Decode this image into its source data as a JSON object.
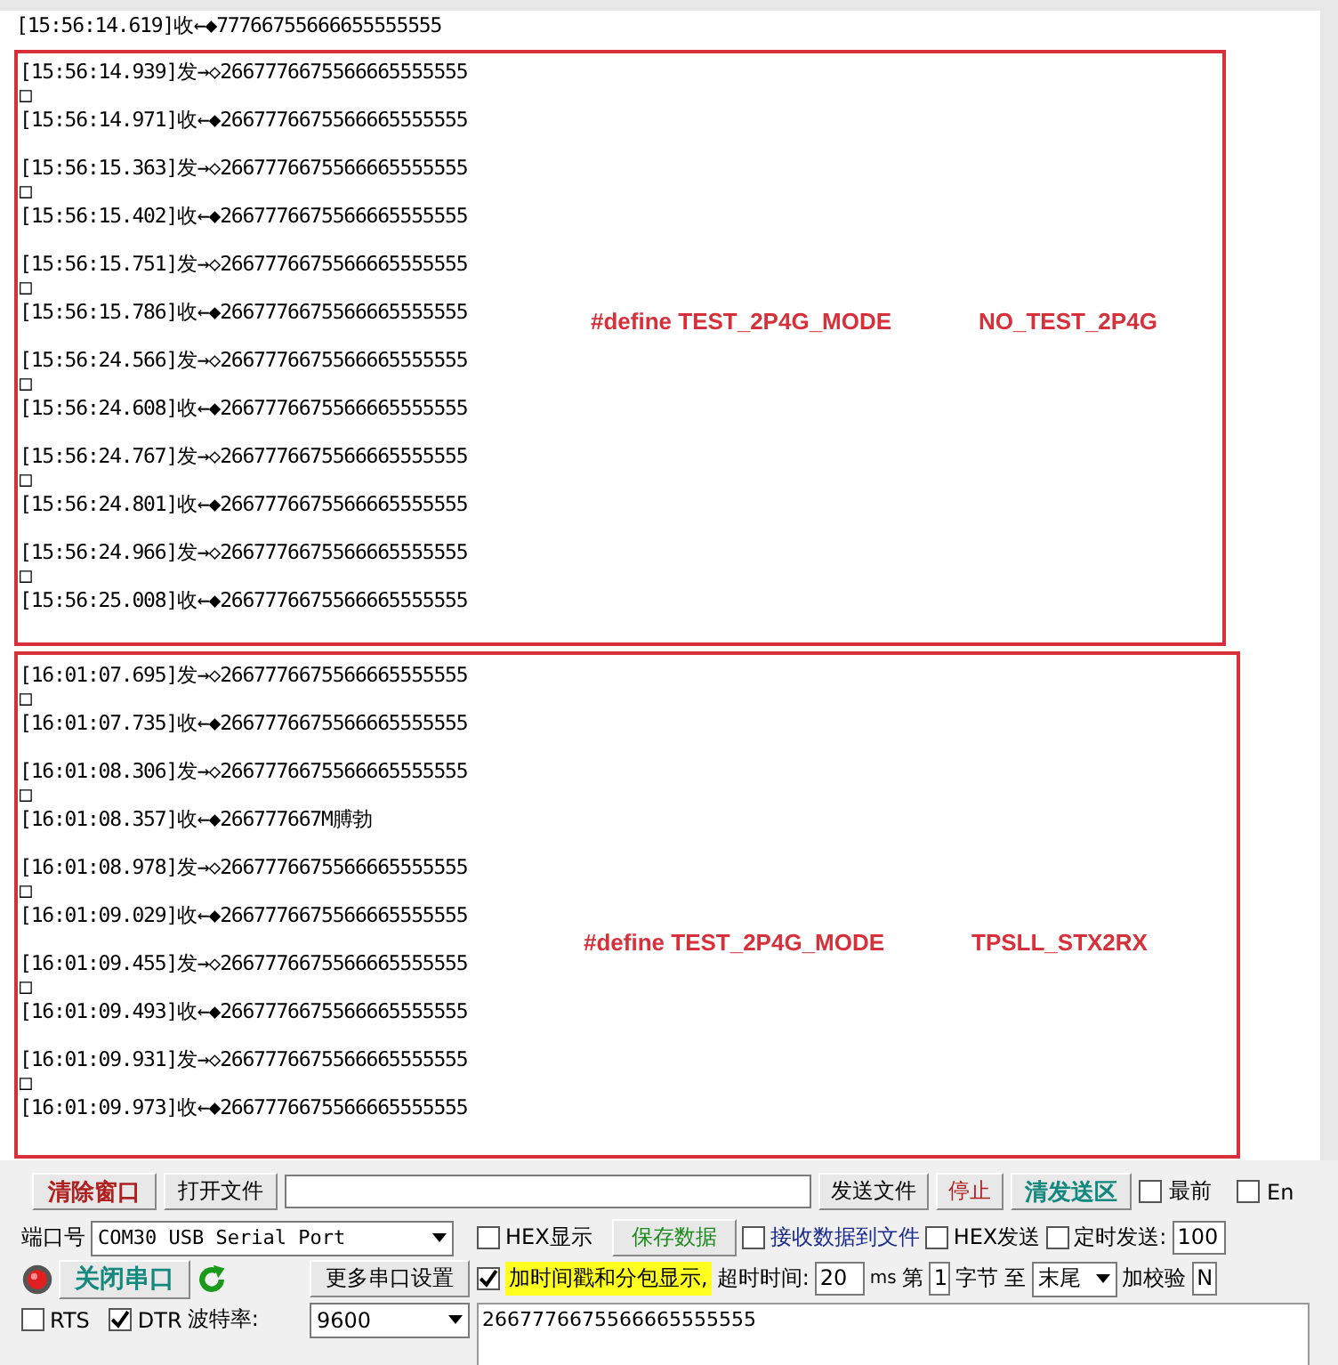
{
  "log": {
    "first_line": "[15:56:14.619]收←◆77766755666655555555",
    "groups": [
      {
        "annotation": {
          "left": "#define TEST_2P4G_MODE",
          "right": "NO_TEST_2P4G"
        },
        "entries": [
          {
            "text": "[15:56:14.939]发→◇2667776675566665555555",
            "trailer": "□"
          },
          {
            "text": "[15:56:14.971]收←◆2667776675566665555555"
          },
          {
            "text": "[15:56:15.363]发→◇2667776675566665555555",
            "trailer": "□"
          },
          {
            "text": "[15:56:15.402]收←◆2667776675566665555555"
          },
          {
            "text": "[15:56:15.751]发→◇2667776675566665555555",
            "trailer": "□"
          },
          {
            "text": "[15:56:15.786]收←◆2667776675566665555555"
          },
          {
            "text": "[15:56:24.566]发→◇2667776675566665555555",
            "trailer": "□"
          },
          {
            "text": "[15:56:24.608]收←◆2667776675566665555555"
          },
          {
            "text": "[15:56:24.767]发→◇2667776675566665555555",
            "trailer": "□"
          },
          {
            "text": "[15:56:24.801]收←◆2667776675566665555555"
          },
          {
            "text": "[15:56:24.966]发→◇2667776675566665555555",
            "trailer": "□"
          },
          {
            "text": "[15:56:25.008]收←◆2667776675566665555555"
          }
        ]
      },
      {
        "annotation": {
          "left": "#define TEST_2P4G_MODE",
          "right": "TPSLL_STX2RX"
        },
        "entries": [
          {
            "text": "[16:01:07.695]发→◇2667776675566665555555",
            "trailer": "□"
          },
          {
            "text": "[16:01:07.735]收←◆2667776675566665555555"
          },
          {
            "text": "[16:01:08.306]发→◇2667776675566665555555",
            "trailer": "□"
          },
          {
            "text": "[16:01:08.357]收←◆266777667M膊勃"
          },
          {
            "text": "[16:01:08.978]发→◇2667776675566665555555",
            "trailer": "□"
          },
          {
            "text": "[16:01:09.029]收←◆2667776675566665555555"
          },
          {
            "text": "[16:01:09.455]发→◇2667776675566665555555",
            "trailer": "□"
          },
          {
            "text": "[16:01:09.493]收←◆2667776675566665555555"
          },
          {
            "text": "[16:01:09.931]发→◇2667776675566665555555",
            "trailer": "□"
          },
          {
            "text": "[16:01:09.973]收←◆2667776675566665555555"
          }
        ]
      }
    ]
  },
  "toolbar": {
    "clear_button": "清除窗口",
    "open_file_button": "打开文件",
    "send_file_button": "发送文件",
    "stop_button": "停止",
    "clear_send_button": "清发送区",
    "topmost": {
      "label": "最前",
      "checked": false
    },
    "english": {
      "label": "En",
      "checked": false
    }
  },
  "port": {
    "label": "端口号",
    "value": "COM30 USB Serial Port",
    "close_button": "关闭串口",
    "more_button": "更多串口设置",
    "rts": {
      "label": "RTS",
      "checked": false
    },
    "dtr": {
      "label": "DTR",
      "checked": true
    },
    "baud_label": "波特率:",
    "baud": "9600"
  },
  "options": {
    "hex_display": {
      "label": "HEX显示",
      "checked": false
    },
    "save_button": "保存数据",
    "recv_to_file": {
      "label": "接收数据到文件",
      "checked": false
    },
    "hex_send": {
      "label": "HEX发送",
      "checked": false
    },
    "timed_send": {
      "label": "定时发送:",
      "checked": false
    },
    "interval": "100",
    "timestamp": {
      "label": "加时间戳和分包显示,",
      "checked": true
    },
    "timeout_label": "超时时间:",
    "timeout": "20",
    "ms": "ms",
    "from_label": "第",
    "from": "1",
    "bytes_to": "字节 至",
    "to": "末尾",
    "checksum_label": "加校验",
    "checksum": "N"
  },
  "send_text": "2667776675566665555555"
}
